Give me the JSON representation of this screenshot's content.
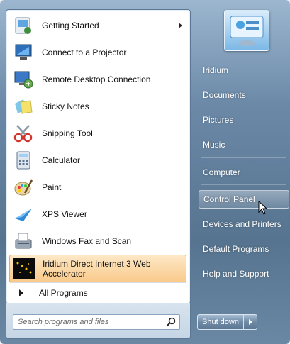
{
  "programs": [
    {
      "label": "Getting Started",
      "icon": "getting-started-icon",
      "submenu": true
    },
    {
      "label": "Connect to a Projector",
      "icon": "projector-icon",
      "submenu": false
    },
    {
      "label": "Remote Desktop Connection",
      "icon": "remote-desktop-icon",
      "submenu": false
    },
    {
      "label": "Sticky Notes",
      "icon": "sticky-notes-icon",
      "submenu": false
    },
    {
      "label": "Snipping Tool",
      "icon": "scissors-icon",
      "submenu": false
    },
    {
      "label": "Calculator",
      "icon": "calculator-icon",
      "submenu": false
    },
    {
      "label": "Paint",
      "icon": "paint-palette-icon",
      "submenu": false
    },
    {
      "label": "XPS Viewer",
      "icon": "xps-viewer-icon",
      "submenu": false
    },
    {
      "label": "Windows Fax and Scan",
      "icon": "fax-scan-icon",
      "submenu": false
    },
    {
      "label": "Iridium Direct Internet 3 Web Accelerator",
      "label_line1": "Iridium Direct Internet 3 Web",
      "label_line2": "Accelerator",
      "icon": "iridium-icon",
      "highlighted": true
    }
  ],
  "all_programs": "All Programs",
  "search": {
    "placeholder": "Search programs and files"
  },
  "right_panel": {
    "items": [
      {
        "label": "Iridium"
      },
      {
        "label": "Documents"
      },
      {
        "label": "Pictures"
      },
      {
        "label": "Music"
      },
      {
        "label": "Computer"
      },
      {
        "label": "Control Panel",
        "hover": true
      },
      {
        "label": "Devices and Printers"
      },
      {
        "label": "Default Programs"
      },
      {
        "label": "Help and Support"
      }
    ]
  },
  "shutdown": {
    "label": "Shut down"
  },
  "colors": {
    "highlight": "#f9c98a",
    "panel": "#6c8aa8"
  }
}
